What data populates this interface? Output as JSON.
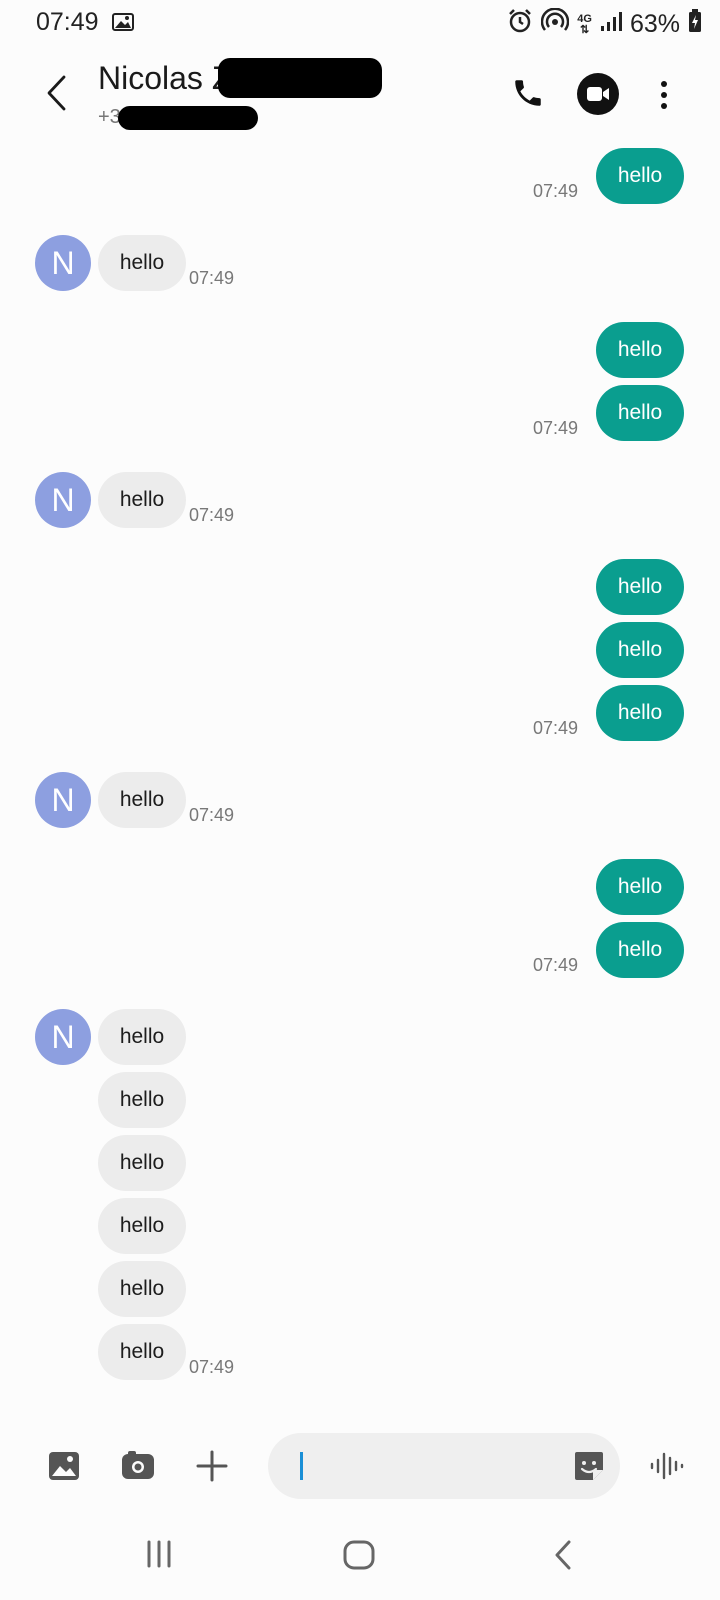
{
  "status_bar": {
    "time": "07:49",
    "network": "4G",
    "battery": "63%",
    "icons": [
      "image-icon",
      "alarm-icon",
      "hotspot-icon",
      "network-4g-icon",
      "signal-icon",
      "battery-charging-icon"
    ]
  },
  "header": {
    "contact_name": "Nicolas Z",
    "contact_number": "+33",
    "icons": [
      "back-arrow-icon",
      "phone-icon",
      "video-call-icon",
      "more-options-icon"
    ]
  },
  "messages": {
    "avatar_letter": "N",
    "g1_out_1": "hello",
    "g1_time": "07:49",
    "g2_in_1": "hello",
    "g2_time": "07:49",
    "g3_out_1": "hello",
    "g3_out_2": "hello",
    "g3_time": "07:49",
    "g4_in_1": "hello",
    "g4_time": "07:49",
    "g5_out_1": "hello",
    "g5_out_2": "hello",
    "g5_out_3": "hello",
    "g5_time": "07:49",
    "g6_in_1": "hello",
    "g6_time": "07:49",
    "g7_out_1": "hello",
    "g7_out_2": "hello",
    "g7_time": "07:49",
    "g8_in_1": "hello",
    "g8_in_2": "hello",
    "g8_in_3": "hello",
    "g8_in_4": "hello",
    "g8_in_5": "hello",
    "g8_in_6": "hello",
    "g8_time": "07:49"
  },
  "composer": {
    "input_value": "",
    "icons": [
      "gallery-icon",
      "camera-icon",
      "plus-icon",
      "sticker-icon",
      "voice-icon"
    ]
  },
  "nav_bar": {
    "icons": [
      "recent-apps-icon",
      "home-icon",
      "back-icon"
    ]
  },
  "colors": {
    "outgoing_bubble": "#0a9e8f",
    "incoming_bubble": "#ececec",
    "avatar": "#8d9fe0"
  }
}
